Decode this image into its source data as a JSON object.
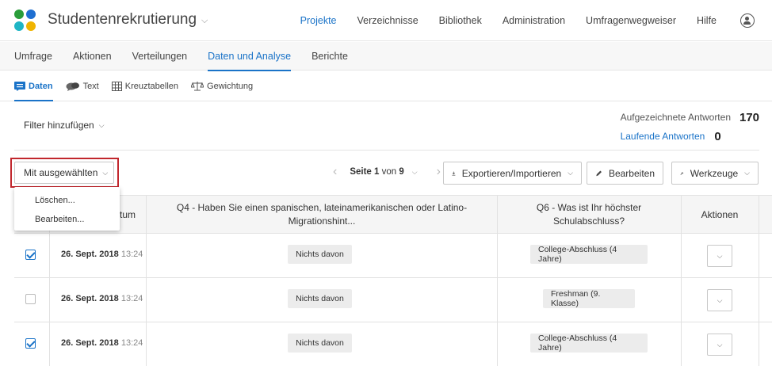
{
  "app": {
    "title": "Studentenrekrutierung"
  },
  "mainnav": [
    "Projekte",
    "Verzeichnisse",
    "Bibliothek",
    "Administration",
    "Umfragenwegweiser",
    "Hilfe"
  ],
  "tabs": [
    "Umfrage",
    "Aktionen",
    "Verteilungen",
    "Daten und Analyse",
    "Berichte"
  ],
  "subtabs": [
    "Daten",
    "Text",
    "Kreuztabellen",
    "Gewichtung"
  ],
  "filter": {
    "label": "Filter hinzufügen"
  },
  "stats": {
    "recorded_label": "Aufgezeichnete Antworten",
    "recorded_value": "170",
    "ongoing_label": "Laufende Antworten",
    "ongoing_value": "0"
  },
  "toolbar": {
    "selected_label": "Mit ausgewählten",
    "page_label": "Seite",
    "page_current": "1",
    "page_of": "von",
    "page_total": "9",
    "export_label": "Exportieren/Importieren",
    "edit_label": "Bearbeiten",
    "tools_label": "Werkzeuge"
  },
  "menu": [
    "Löschen...",
    "Bearbeiten..."
  ],
  "table": {
    "headers": {
      "date_partial": "tum",
      "q4": "Q4 - Haben Sie einen spanischen, lateinamerikanischen oder Latino-Migrationshint...",
      "q6": "Q6 - Was ist Ihr höchster Schulabschluss?",
      "actions": "Aktionen"
    },
    "rows": [
      {
        "checked": true,
        "date": "26. Sept. 2018",
        "time": "13:24",
        "q4": "Nichts davon",
        "q6": "College-Abschluss (4 Jahre)"
      },
      {
        "checked": false,
        "date": "26. Sept. 2018",
        "time": "13:24",
        "q4": "Nichts davon",
        "q6": "Freshman (9. Klasse)"
      },
      {
        "checked": true,
        "date": "26. Sept. 2018",
        "time": "13:24",
        "q4": "Nichts davon",
        "q6": "College-Abschluss (4 Jahre)"
      }
    ]
  },
  "colors": {
    "accent": "#1a73c8",
    "highlight": "#c1272d",
    "logo": [
      "#2a9d3a",
      "#1f6fd1",
      "#f0b400",
      "#1fb5c5"
    ]
  }
}
